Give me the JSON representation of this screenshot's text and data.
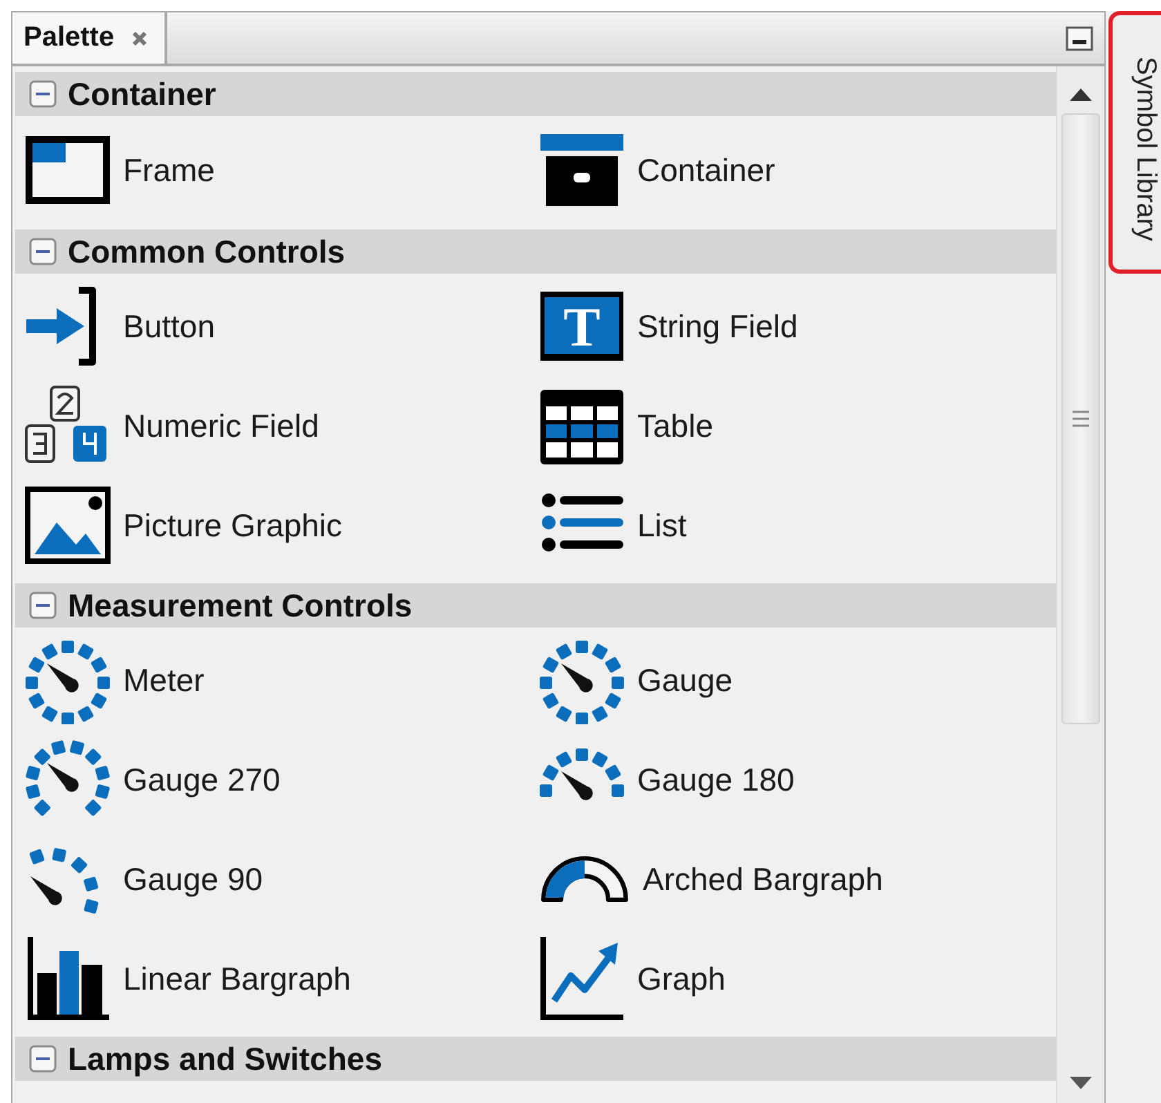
{
  "panel_tab": {
    "title": "Palette",
    "selected": true
  },
  "side_tab": {
    "label": "Symbol Library",
    "highlighted": true
  },
  "sections": [
    {
      "title": "Container",
      "expanded": true,
      "items": [
        {
          "label": "Frame",
          "kind": "frame"
        },
        {
          "label": "Container",
          "kind": "container"
        }
      ]
    },
    {
      "title": "Common Controls",
      "expanded": true,
      "items": [
        {
          "label": "Button",
          "kind": "button"
        },
        {
          "label": "String Field",
          "kind": "string",
          "glyph": "T"
        },
        {
          "label": "Numeric Field",
          "kind": "numeric"
        },
        {
          "label": "Table",
          "kind": "table"
        },
        {
          "label": "Picture Graphic",
          "kind": "picture"
        },
        {
          "label": "List",
          "kind": "list"
        }
      ]
    },
    {
      "title": "Measurement Controls",
      "expanded": true,
      "items": [
        {
          "label": "Meter",
          "kind": "meter"
        },
        {
          "label": "Gauge",
          "kind": "gauge"
        },
        {
          "label": "Gauge 270",
          "kind": "gauge270"
        },
        {
          "label": "Gauge 180",
          "kind": "gauge180"
        },
        {
          "label": "Gauge 90",
          "kind": "gauge90"
        },
        {
          "label": "Arched Bargraph",
          "kind": "arched"
        },
        {
          "label": "Linear Bargraph",
          "kind": "linear"
        },
        {
          "label": "Graph",
          "kind": "graph"
        }
      ]
    },
    {
      "title": "Lamps and Switches",
      "expanded": true
    }
  ]
}
